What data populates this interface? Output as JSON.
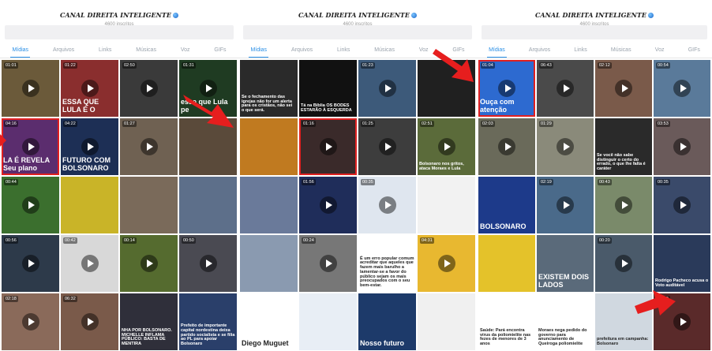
{
  "panels": [
    {
      "channel_title": "CANAL DIREITA INTELIGENTE",
      "subscribers": "4600 inscritos",
      "tabs": [
        "Mídias",
        "Arquivos",
        "Links",
        "Músicas",
        "Voz",
        "GIFs"
      ],
      "cells": [
        {
          "dur": "01:01",
          "cap": "",
          "bg": "#6b5a3a"
        },
        {
          "dur": "01:22",
          "cap": "ESSA QUE LULA É O",
          "bg": "#8a2e2e"
        },
        {
          "dur": "02:50",
          "cap": "",
          "bg": "#3a3a3a"
        },
        {
          "dur": "01:31",
          "cap": "esse que Lula pe",
          "bg": "#1f3b22"
        },
        {
          "dur": "04:16",
          "cap": "LA É REVELA Seu plano",
          "bg": "#5b2d6e"
        },
        {
          "dur": "04:22",
          "cap": "FUTURO COM BOLSONARO",
          "bg": "#1d2f55"
        },
        {
          "dur": "01:27",
          "cap": "",
          "bg": "#6f6152"
        },
        {
          "dur": "",
          "cap": "",
          "bg": "#5a4a3a"
        },
        {
          "dur": "00:44",
          "cap": "",
          "bg": "#3b6f2e"
        },
        {
          "dur": "",
          "cap": "",
          "bg": "#c9b428"
        },
        {
          "dur": "",
          "cap": "",
          "bg": "#7a6a5a"
        },
        {
          "dur": "",
          "cap": "",
          "bg": "#5d6f8a"
        },
        {
          "dur": "00:56",
          "cap": "",
          "bg": "#2d3a4a"
        },
        {
          "dur": "00:42",
          "cap": "",
          "bg": "#d8d8d8"
        },
        {
          "dur": "00:14",
          "cap": "",
          "bg": "#556b2f"
        },
        {
          "dur": "00:50",
          "cap": "",
          "bg": "#4a4a52"
        },
        {
          "dur": "02:18",
          "cap": "",
          "bg": "#8a6a5a"
        },
        {
          "dur": "06:32",
          "cap": "",
          "bg": "#7a5a4a"
        },
        {
          "dur": "",
          "cap": "NHA POR BOLSONARO. MICHELLE INFLAMA PÚBLICO: BASTA DE MENTIRA",
          "bg": "#2f2f3a"
        },
        {
          "dur": "",
          "cap": "Prefeito de importante capital nordestina deixa partido socialista e se filia ao PL para apoiar Bolsonaro",
          "bg": "#2a3f6a"
        }
      ]
    },
    {
      "channel_title": "CANAL DIREITA INTELIGENTE",
      "subscribers": "4600 inscritos",
      "tabs": [
        "Mídias",
        "Arquivos",
        "Links",
        "Músicas",
        "Voz",
        "GIFs"
      ],
      "cells": [
        {
          "dur": "",
          "cap": "Se o fechamento das igrejas não for um alerta para os cristãos, não sei o que será.",
          "bg": "#2a2a2a"
        },
        {
          "dur": "",
          "cap": "Tá na Bíblia OS BODES ESTARÃO À ESQUERDA",
          "bg": "#111111"
        },
        {
          "dur": "01:23",
          "cap": "",
          "bg": "#3d5a7a"
        },
        {
          "dur": "",
          "cap": "",
          "bg": "#202020"
        },
        {
          "dur": "",
          "cap": "",
          "bg": "#c07a20"
        },
        {
          "dur": "01:16",
          "cap": "",
          "bg": "#3a2a2a"
        },
        {
          "dur": "01:25",
          "cap": "",
          "bg": "#3d3d3d"
        },
        {
          "dur": "02:51",
          "cap": "Bolsonaro nos gritos, ataca Moraes e Lula",
          "bg": "#5b6b3a"
        },
        {
          "dur": "",
          "cap": "",
          "bg": "#6a7a9a"
        },
        {
          "dur": "01:56",
          "cap": "",
          "bg": "#1f2d5a"
        },
        {
          "dur": "00:35",
          "cap": "",
          "bg": "#dfe6ef"
        },
        {
          "dur": "",
          "cap": "",
          "bg": "#f2f2f2"
        },
        {
          "dur": "",
          "cap": "",
          "bg": "#8a9ab0"
        },
        {
          "dur": "00:24",
          "cap": "",
          "bg": "#777777"
        },
        {
          "dur": "",
          "cap": "É um erro popular comum acreditar que aqueles que fazem mais barulho a lamentar-se a favor do público sejam os mais preocupados com o seu bem-estar.",
          "bg": "#ffffff"
        },
        {
          "dur": "04:31",
          "cap": "",
          "bg": "#e8b830"
        },
        {
          "dur": "",
          "cap": "Diego Muguet",
          "bg": "#ffffff"
        },
        {
          "dur": "",
          "cap": "",
          "bg": "#e8eef5"
        },
        {
          "dur": "",
          "cap": "Nosso futuro",
          "bg": "#1d3a6a"
        },
        {
          "dur": "",
          "cap": "",
          "bg": "#f0f0f0"
        }
      ]
    },
    {
      "channel_title": "CANAL DIREITA INTELIGENTE",
      "subscribers": "4600 inscritos",
      "tabs": [
        "Mídias",
        "Arquivos",
        "Links",
        "Músicas",
        "Voz",
        "GIFs"
      ],
      "cells": [
        {
          "dur": "01:04",
          "cap": "Ouça com atenção",
          "bg": "#2d6ad0"
        },
        {
          "dur": "06:43",
          "cap": "",
          "bg": "#4a4a4a"
        },
        {
          "dur": "02:12",
          "cap": "",
          "bg": "#7a5a4a"
        },
        {
          "dur": "00:54",
          "cap": "",
          "bg": "#5a7a9a"
        },
        {
          "dur": "02:03",
          "cap": "",
          "bg": "#6a6a5a"
        },
        {
          "dur": "01:29",
          "cap": "",
          "bg": "#8a8a7a"
        },
        {
          "dur": "",
          "cap": "Se você não sabe distinguir o certo do errado, o que lhe falta é caráter",
          "bg": "#2a2a2a"
        },
        {
          "dur": "03:53",
          "cap": "",
          "bg": "#6a5a5a"
        },
        {
          "dur": "",
          "cap": "BOLSONARO",
          "bg": "#1d3a8a"
        },
        {
          "dur": "02:19",
          "cap": "",
          "bg": "#4a6a8a"
        },
        {
          "dur": "00:43",
          "cap": "",
          "bg": "#7a8a6a"
        },
        {
          "dur": "00:35",
          "cap": "",
          "bg": "#3a4a6a"
        },
        {
          "dur": "",
          "cap": "",
          "bg": "#e4c22a"
        },
        {
          "dur": "",
          "cap": "EXISTEM DOIS LADOS",
          "bg": "#5a6a7a"
        },
        {
          "dur": "00:20",
          "cap": "",
          "bg": "#4a5a6a"
        },
        {
          "dur": "",
          "cap": "Rodrigo Pacheco acusa o Voto auditável",
          "bg": "#2a3a5a"
        },
        {
          "dur": "",
          "cap": "Saúde: Pará encontra vírus da poliomielite nas fezes de menores de 3 anos",
          "bg": "#ffffff"
        },
        {
          "dur": "",
          "cap": "Moraes nega pedido do governo para anunciamento de Queiroga poliomielite",
          "bg": "#ffffff"
        },
        {
          "dur": "",
          "cap": "prefeitura em campanha: Bolsonaro",
          "bg": "#d0d8e0"
        },
        {
          "dur": "00:10",
          "cap": "",
          "bg": "#5a2a2a"
        }
      ]
    }
  ]
}
